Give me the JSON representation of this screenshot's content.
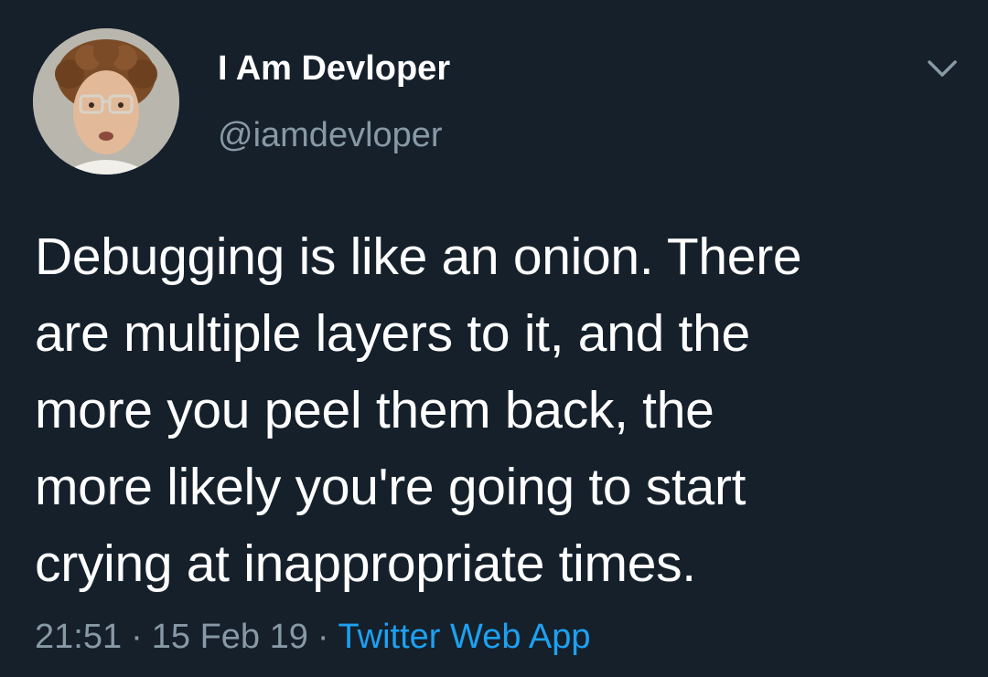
{
  "tweet": {
    "author": {
      "display_name": "I Am Devloper",
      "handle": "@iamdevloper",
      "avatar_icon": "user-avatar"
    },
    "menu_icon": "chevron-down-icon",
    "text": "Debugging is like an onion. There\nare multiple layers to it, and the\nmore you peel them back, the\nmore likely you're going to start\ncrying at inappropriate times.",
    "time": "21:51",
    "separator": "·",
    "date": "15 Feb 19",
    "source": "Twitter Web App"
  },
  "colors": {
    "background": "#15202b",
    "primary_text": "#ffffff",
    "secondary_text": "#8899a6",
    "link": "#1da1f2"
  }
}
